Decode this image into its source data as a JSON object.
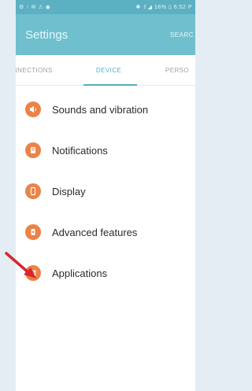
{
  "status_bar": {
    "left": "⚙ ↑ ✉ ⚠ ◉",
    "right": "✱ ⇧◢ 16% ▯ 6:52 P"
  },
  "app_bar": {
    "title": "Settings",
    "search_label": "SEARC"
  },
  "tabs": [
    {
      "label": "NNECTIONS"
    },
    {
      "label": "DEVICE"
    },
    {
      "label": "PERSO"
    }
  ],
  "list": [
    {
      "label": "Sounds and vibration",
      "icon": "speaker-icon"
    },
    {
      "label": "Notifications",
      "icon": "bell-icon"
    },
    {
      "label": "Display",
      "icon": "phone-icon"
    },
    {
      "label": "Advanced features",
      "icon": "gear-icon"
    },
    {
      "label": "Applications",
      "icon": "grid-icon"
    }
  ],
  "colors": {
    "accent": "#55aebf",
    "app_bar": "#6fbfcf",
    "icon_bg": "#ec8246",
    "annotation_arrow": "#d9262c"
  }
}
